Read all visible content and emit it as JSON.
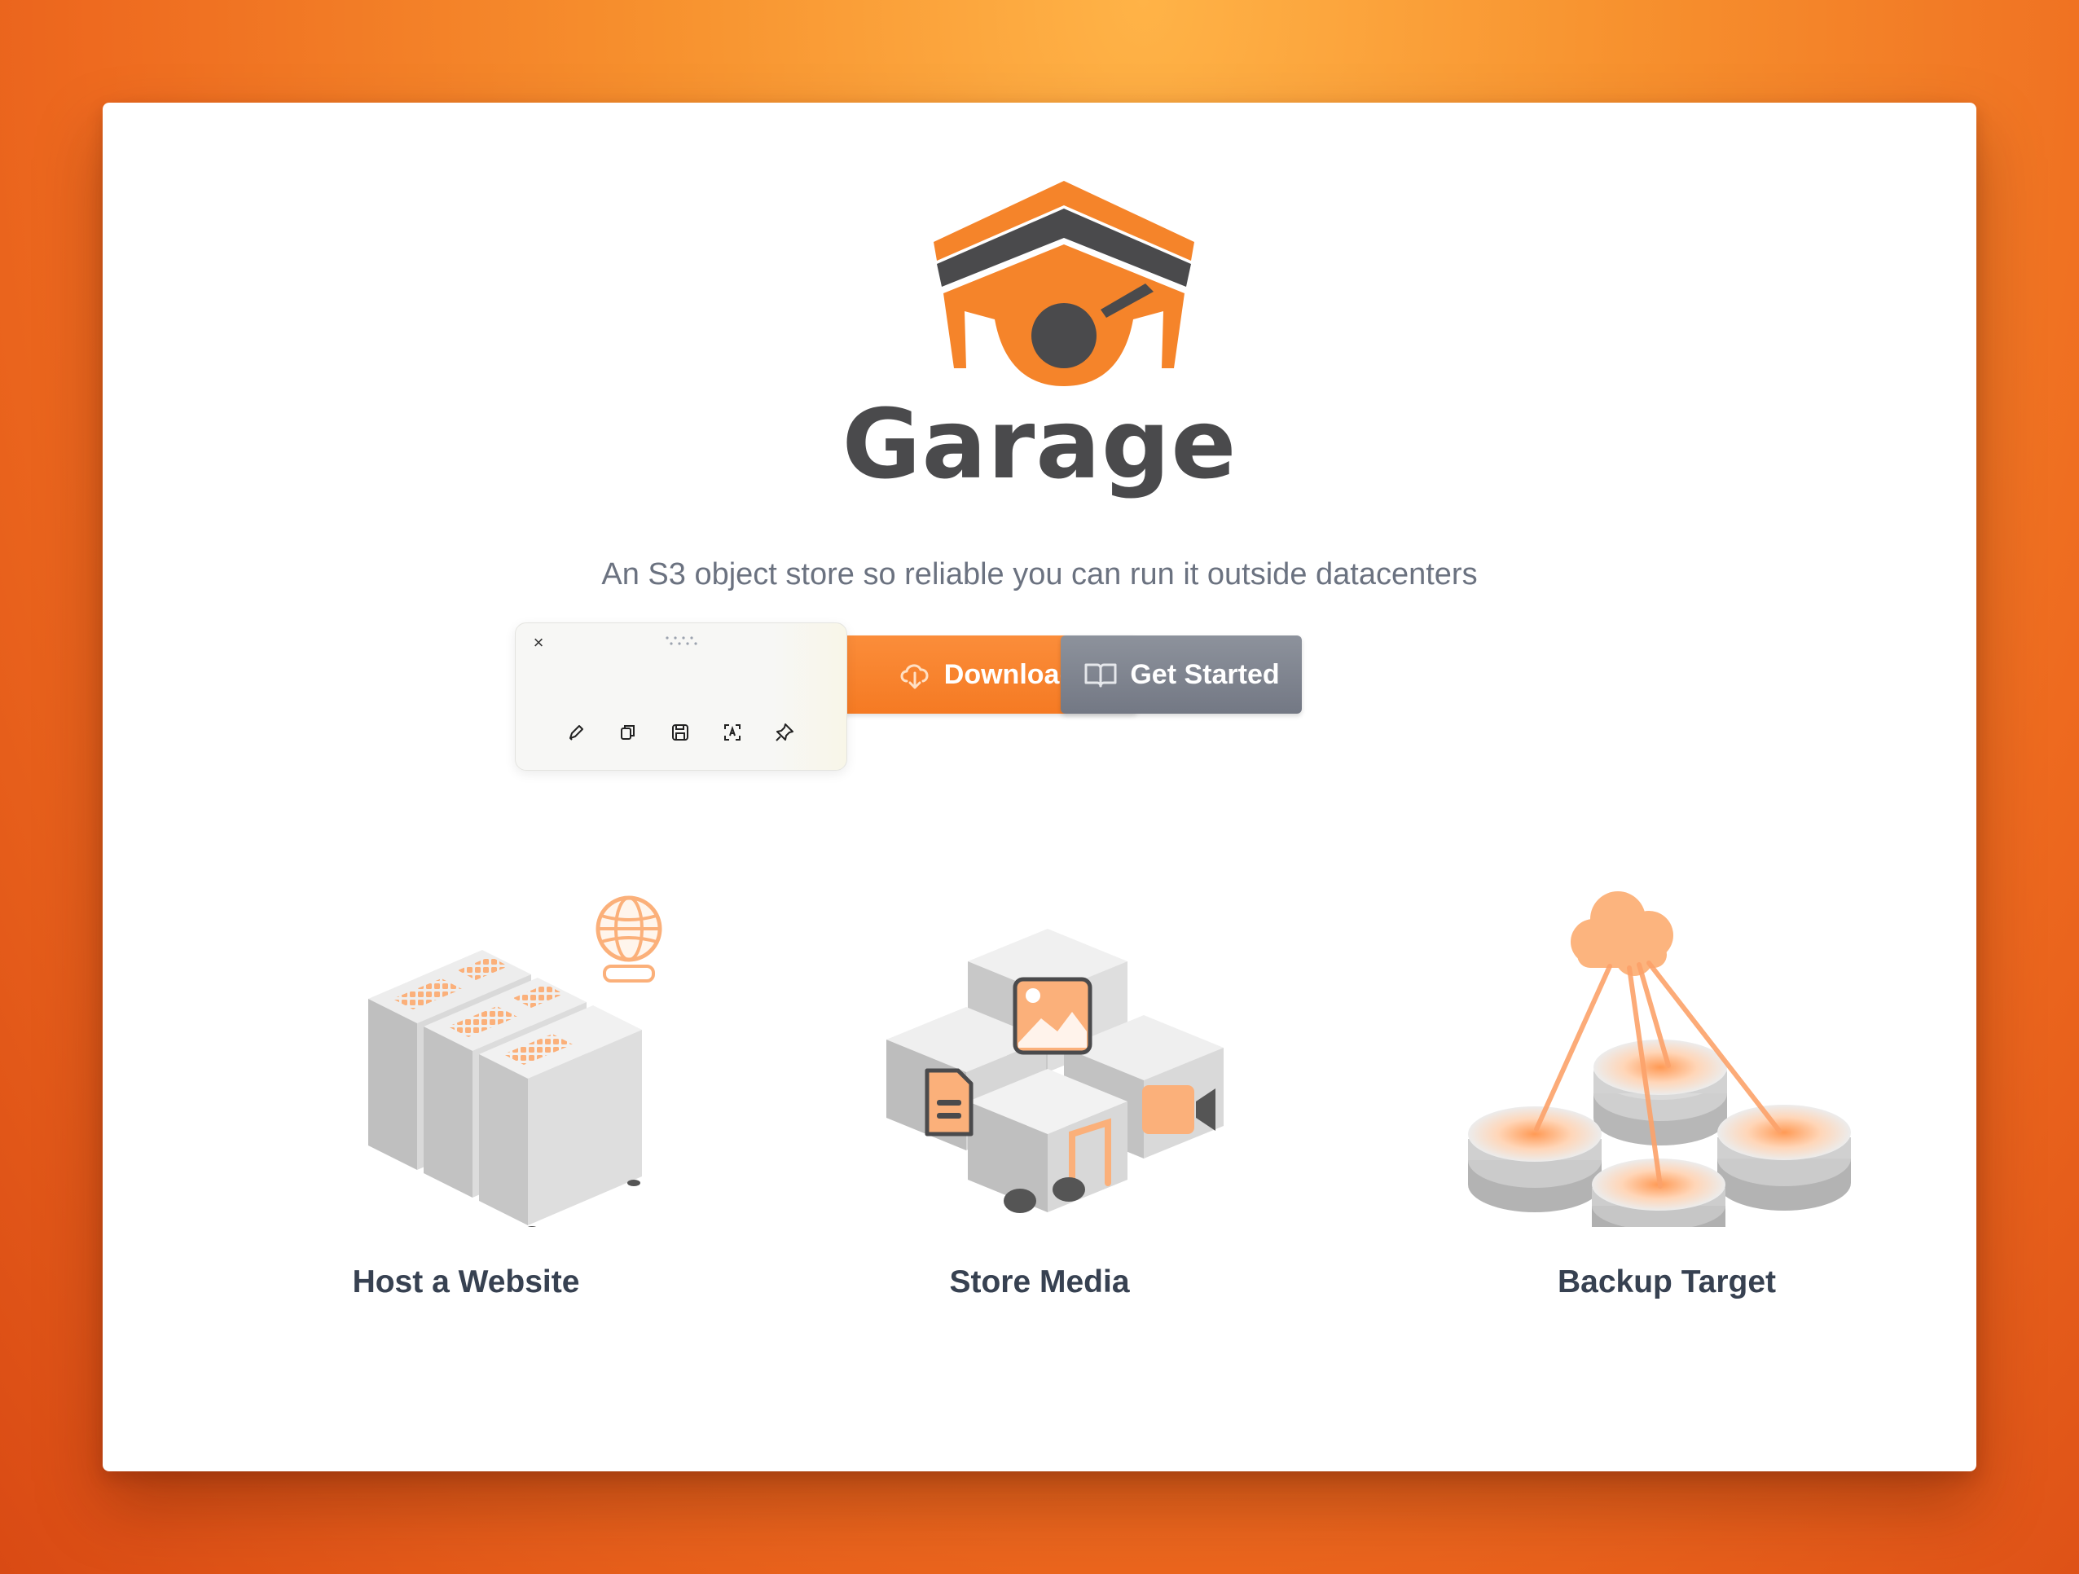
{
  "brand": {
    "name": "Garage",
    "tagline": "An S3 object store so reliable you can run it outside datacenters"
  },
  "actions": {
    "download_label": "Download",
    "get_started_label": "Get Started"
  },
  "toolbar": {
    "close_glyph": "×",
    "tools": [
      "pencil-icon",
      "copy-icon",
      "save-icon",
      "text-recognize-icon",
      "pin-icon"
    ]
  },
  "features": [
    {
      "label": "Host a Website",
      "icon": "server-rack-globe-illustration"
    },
    {
      "label": "Store Media",
      "icon": "media-cubes-illustration"
    },
    {
      "label": "Backup Target",
      "icon": "cloud-backup-disks-illustration"
    }
  ],
  "colors": {
    "accent": "#f5842a",
    "logo_dark": "#4a4a4c",
    "button_secondary": "#7d828d",
    "text_muted": "#6b7280",
    "text_heading": "#374151"
  }
}
